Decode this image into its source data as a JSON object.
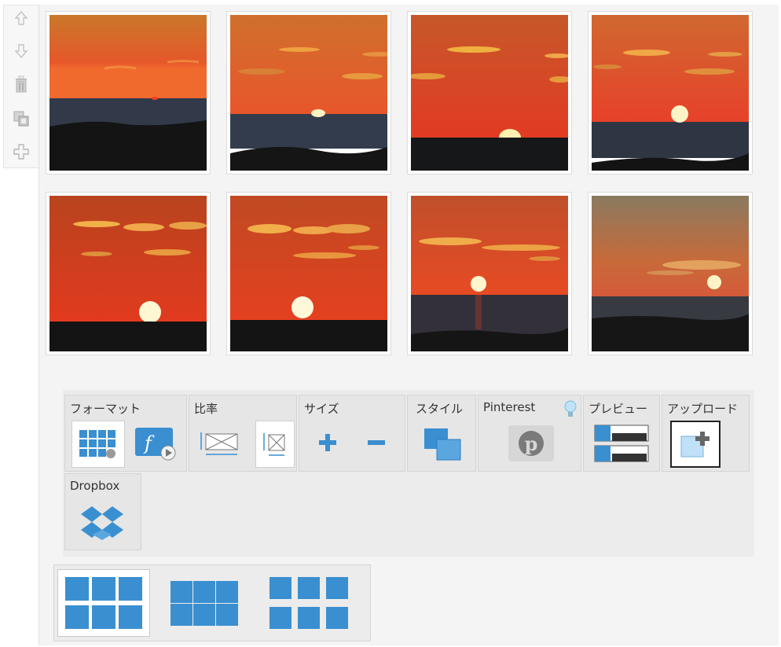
{
  "side_tools": [
    {
      "icon": "move-up-icon"
    },
    {
      "icon": "move-down-icon"
    },
    {
      "icon": "trash-icon"
    },
    {
      "icon": "duplicate-icon"
    },
    {
      "icon": "add-icon"
    }
  ],
  "photos": [
    {
      "name": "sunset-photo-1"
    },
    {
      "name": "sunset-photo-2"
    },
    {
      "name": "sunset-photo-3"
    },
    {
      "name": "sunset-photo-4"
    },
    {
      "name": "sunset-photo-5"
    },
    {
      "name": "sunset-photo-6"
    },
    {
      "name": "sunset-photo-7"
    },
    {
      "name": "sunset-photo-8"
    }
  ],
  "toolbar": {
    "format": {
      "label": "フォーマット"
    },
    "ratio": {
      "label": "比率"
    },
    "size": {
      "label": "サイズ"
    },
    "style": {
      "label": "スタイル"
    },
    "pinterest": {
      "label": "Pinterest"
    },
    "preview": {
      "label": "プレビュー"
    },
    "upload": {
      "label": "アップロード"
    },
    "dropbox": {
      "label": "Dropbox"
    }
  },
  "colors": {
    "accent": "#3a8fd0",
    "pinterest": "#7a7a7a",
    "tooltip_bulb": "#9fd3f2"
  },
  "layouts": [
    {
      "icon": "grid-3x2-gap-icon",
      "selected": true
    },
    {
      "icon": "grid-3x2-tight-icon",
      "selected": false
    },
    {
      "icon": "grid-3x2-spaced-icon",
      "selected": false
    }
  ]
}
